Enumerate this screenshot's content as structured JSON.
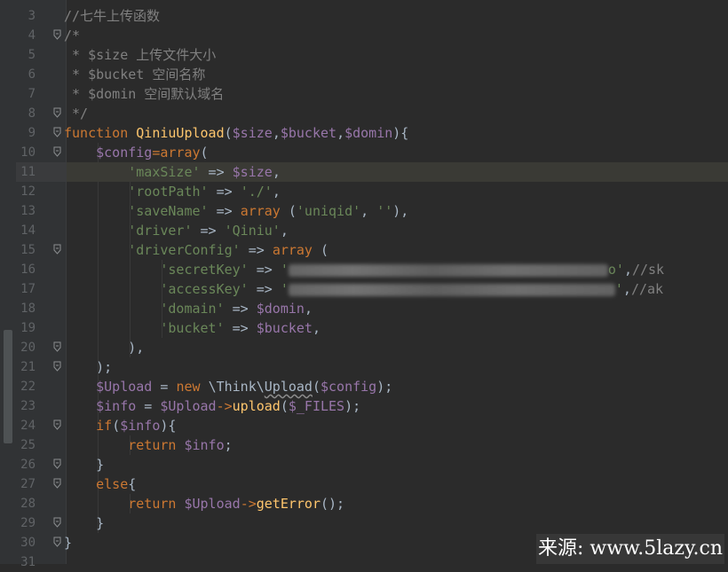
{
  "editor": {
    "lines": [
      {
        "n": "3",
        "tokens": [
          {
            "t": "comment",
            "v": "//七牛上传函数"
          }
        ]
      },
      {
        "n": "4",
        "tokens": [
          {
            "t": "comment",
            "v": "/*"
          }
        ]
      },
      {
        "n": "5",
        "tokens": [
          {
            "t": "comment",
            "v": " * $size 上传文件大小"
          }
        ]
      },
      {
        "n": "6",
        "tokens": [
          {
            "t": "comment",
            "v": " * $bucket 空间名称"
          }
        ]
      },
      {
        "n": "7",
        "tokens": [
          {
            "t": "comment",
            "v": " * $domin 空间默认域名"
          }
        ]
      },
      {
        "n": "8",
        "tokens": [
          {
            "t": "comment",
            "v": " */"
          }
        ]
      },
      {
        "n": "9",
        "tokens": [
          {
            "t": "keyword",
            "v": "function "
          },
          {
            "t": "fn",
            "v": "QiniuUpload"
          },
          {
            "t": "ident",
            "v": "("
          },
          {
            "t": "var",
            "v": "$size"
          },
          {
            "t": "ident",
            "v": ","
          },
          {
            "t": "var",
            "v": "$bucket"
          },
          {
            "t": "ident",
            "v": ","
          },
          {
            "t": "var",
            "v": "$domin"
          },
          {
            "t": "ident",
            "v": "){"
          }
        ]
      },
      {
        "n": "10",
        "tokens": [
          {
            "t": "ident",
            "v": "    "
          },
          {
            "t": "var",
            "v": "$config"
          },
          {
            "t": "keyword",
            "v": "=array"
          },
          {
            "t": "ident",
            "v": "("
          }
        ]
      },
      {
        "n": "11",
        "tokens": [
          {
            "t": "ident",
            "v": "        "
          },
          {
            "t": "str",
            "v": "'maxSize'"
          },
          {
            "t": "ident",
            "v": " => "
          },
          {
            "t": "var",
            "v": "$size"
          },
          {
            "t": "ident",
            "v": ","
          }
        ]
      },
      {
        "n": "12",
        "tokens": [
          {
            "t": "ident",
            "v": "        "
          },
          {
            "t": "str",
            "v": "'rootPath'"
          },
          {
            "t": "ident",
            "v": " => "
          },
          {
            "t": "str",
            "v": "'./'"
          },
          {
            "t": "ident",
            "v": ","
          }
        ]
      },
      {
        "n": "13",
        "tokens": [
          {
            "t": "ident",
            "v": "        "
          },
          {
            "t": "str",
            "v": "'saveName'"
          },
          {
            "t": "ident",
            "v": " => "
          },
          {
            "t": "keyword",
            "v": "array"
          },
          {
            "t": "ident",
            "v": " ("
          },
          {
            "t": "str",
            "v": "'uniqid'"
          },
          {
            "t": "ident",
            "v": ", "
          },
          {
            "t": "str",
            "v": "''"
          },
          {
            "t": "ident",
            "v": "),"
          }
        ]
      },
      {
        "n": "14",
        "tokens": [
          {
            "t": "ident",
            "v": "        "
          },
          {
            "t": "str",
            "v": "'driver'"
          },
          {
            "t": "ident",
            "v": " => "
          },
          {
            "t": "str",
            "v": "'Qiniu'"
          },
          {
            "t": "ident",
            "v": ","
          }
        ]
      },
      {
        "n": "15",
        "tokens": [
          {
            "t": "ident",
            "v": "        "
          },
          {
            "t": "str",
            "v": "'driverConfig'"
          },
          {
            "t": "ident",
            "v": " => "
          },
          {
            "t": "keyword",
            "v": "array"
          },
          {
            "t": "ident",
            "v": " ("
          }
        ]
      },
      {
        "n": "16",
        "tokens": [
          {
            "t": "ident",
            "v": "            "
          },
          {
            "t": "str",
            "v": "'secretKey'"
          },
          {
            "t": "ident",
            "v": " => "
          },
          {
            "t": "str",
            "v": "'"
          },
          {
            "t": "redact",
            "v": "360"
          },
          {
            "t": "str",
            "v": "o'"
          },
          {
            "t": "ident",
            "v": ","
          },
          {
            "t": "comment",
            "v": "//sk"
          }
        ]
      },
      {
        "n": "17",
        "tokens": [
          {
            "t": "ident",
            "v": "            "
          },
          {
            "t": "str",
            "v": "'accessKey'"
          },
          {
            "t": "ident",
            "v": " => "
          },
          {
            "t": "str",
            "v": "'"
          },
          {
            "t": "redact",
            "v": "368"
          },
          {
            "t": "str",
            "v": "'"
          },
          {
            "t": "ident",
            "v": ","
          },
          {
            "t": "comment",
            "v": "//ak"
          }
        ]
      },
      {
        "n": "18",
        "tokens": [
          {
            "t": "ident",
            "v": "            "
          },
          {
            "t": "str",
            "v": "'domain'"
          },
          {
            "t": "ident",
            "v": " => "
          },
          {
            "t": "var",
            "v": "$domin"
          },
          {
            "t": "ident",
            "v": ","
          }
        ]
      },
      {
        "n": "19",
        "tokens": [
          {
            "t": "ident",
            "v": "            "
          },
          {
            "t": "str",
            "v": "'bucket'"
          },
          {
            "t": "ident",
            "v": " => "
          },
          {
            "t": "var",
            "v": "$bucket"
          },
          {
            "t": "ident",
            "v": ","
          }
        ]
      },
      {
        "n": "20",
        "tokens": [
          {
            "t": "ident",
            "v": "        ),"
          }
        ]
      },
      {
        "n": "21",
        "tokens": [
          {
            "t": "ident",
            "v": "    );"
          }
        ]
      },
      {
        "n": "22",
        "tokens": [
          {
            "t": "ident",
            "v": "    "
          },
          {
            "t": "var",
            "v": "$Upload"
          },
          {
            "t": "ident",
            "v": " = "
          },
          {
            "t": "keyword",
            "v": "new "
          },
          {
            "t": "ident",
            "v": "\\Think\\"
          },
          {
            "t": "wave",
            "v": "Upload"
          },
          {
            "t": "ident",
            "v": "("
          },
          {
            "t": "var",
            "v": "$config"
          },
          {
            "t": "ident",
            "v": ");"
          }
        ]
      },
      {
        "n": "23",
        "tokens": [
          {
            "t": "ident",
            "v": "    "
          },
          {
            "t": "var",
            "v": "$info"
          },
          {
            "t": "ident",
            "v": " = "
          },
          {
            "t": "var",
            "v": "$Upload"
          },
          {
            "t": "keyword",
            "v": "->"
          },
          {
            "t": "fn",
            "v": "upload"
          },
          {
            "t": "ident",
            "v": "("
          },
          {
            "t": "var",
            "v": "$_FILES"
          },
          {
            "t": "ident",
            "v": ");"
          }
        ]
      },
      {
        "n": "24",
        "tokens": [
          {
            "t": "ident",
            "v": "    "
          },
          {
            "t": "keyword",
            "v": "if"
          },
          {
            "t": "ident",
            "v": "("
          },
          {
            "t": "var",
            "v": "$info"
          },
          {
            "t": "ident",
            "v": "){"
          }
        ]
      },
      {
        "n": "25",
        "tokens": [
          {
            "t": "ident",
            "v": "        "
          },
          {
            "t": "keyword",
            "v": "return "
          },
          {
            "t": "var",
            "v": "$info"
          },
          {
            "t": "ident",
            "v": ";"
          }
        ]
      },
      {
        "n": "26",
        "tokens": [
          {
            "t": "ident",
            "v": "    }"
          }
        ]
      },
      {
        "n": "27",
        "tokens": [
          {
            "t": "ident",
            "v": "    "
          },
          {
            "t": "keyword",
            "v": "else"
          },
          {
            "t": "ident",
            "v": "{"
          }
        ]
      },
      {
        "n": "28",
        "tokens": [
          {
            "t": "ident",
            "v": "        "
          },
          {
            "t": "keyword",
            "v": "return "
          },
          {
            "t": "var",
            "v": "$Upload"
          },
          {
            "t": "keyword",
            "v": "->"
          },
          {
            "t": "fn",
            "v": "getError"
          },
          {
            "t": "ident",
            "v": "();"
          }
        ]
      },
      {
        "n": "29",
        "tokens": [
          {
            "t": "ident",
            "v": "    }"
          }
        ]
      },
      {
        "n": "30",
        "tokens": [
          {
            "t": "ident",
            "v": "}"
          }
        ]
      },
      {
        "n": "31",
        "tokens": []
      }
    ],
    "current_line": "11",
    "fold_markers": [
      "4",
      "8",
      "9",
      "10",
      "15",
      "20",
      "21",
      "24",
      "26",
      "27",
      "29",
      "30"
    ]
  },
  "watermark": {
    "text": "来源: www.5lazy.cn"
  },
  "colors": {
    "background": "#2b2b2b",
    "gutter": "#313335",
    "comment": "#808080",
    "keyword": "#cc7832",
    "function": "#ffc66d",
    "variable": "#9876aa",
    "string": "#6a8759",
    "text": "#a9b7c6"
  }
}
